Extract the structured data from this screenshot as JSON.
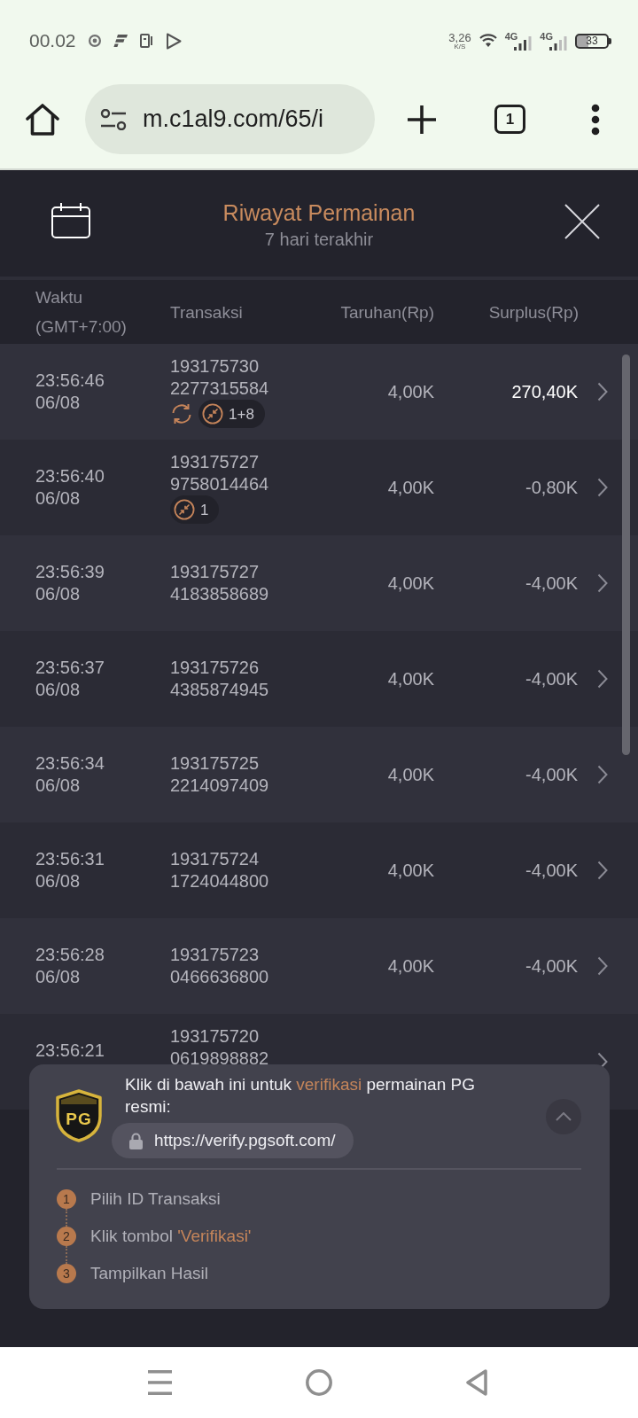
{
  "status_bar": {
    "time": "00.02",
    "net_speed": "3,26",
    "net_speed_unit": "K/S",
    "networks": [
      {
        "label": "4G"
      },
      {
        "label": "4G"
      }
    ],
    "battery": "33"
  },
  "browser_bar": {
    "url": "m.c1al9.com/65/i",
    "tab_count": "1"
  },
  "header": {
    "title": "Riwayat Permainan",
    "subtitle": "7 hari terakhir"
  },
  "table": {
    "columns": [
      "Waktu (GMT+7:00)",
      "Transaksi",
      "Taruhan(Rp)",
      "Surplus(Rp)"
    ],
    "rows": [
      {
        "time": "23:56:46",
        "date": "06/08",
        "transaction_id": [
          "193175730",
          "2277315584"
        ],
        "bet": "4,00K",
        "surplus": "270,40K",
        "positive": true,
        "tags": [
          {
            "kind": "refresh"
          },
          {
            "kind": "count",
            "text": "1+8"
          }
        ]
      },
      {
        "time": "23:56:40",
        "date": "06/08",
        "transaction_id": [
          "193175727",
          "9758014464"
        ],
        "bet": "4,00K",
        "surplus": "-0,80K",
        "positive": false,
        "tags": [
          {
            "kind": "count",
            "text": "1"
          }
        ]
      },
      {
        "time": "23:56:39",
        "date": "06/08",
        "transaction_id": [
          "193175727",
          "4183858689"
        ],
        "bet": "4,00K",
        "surplus": "-4,00K",
        "positive": false
      },
      {
        "time": "23:56:37",
        "date": "06/08",
        "transaction_id": [
          "193175726",
          "4385874945"
        ],
        "bet": "4,00K",
        "surplus": "-4,00K",
        "positive": false
      },
      {
        "time": "23:56:34",
        "date": "06/08",
        "transaction_id": [
          "193175725",
          "2214097409"
        ],
        "bet": "4,00K",
        "surplus": "-4,00K",
        "positive": false
      },
      {
        "time": "23:56:31",
        "date": "06/08",
        "transaction_id": [
          "193175724",
          "1724044800"
        ],
        "bet": "4,00K",
        "surplus": "-4,00K",
        "positive": false
      },
      {
        "time": "23:56:28",
        "date": "06/08",
        "transaction_id": [
          "193175723",
          "0466636800"
        ],
        "bet": "4,00K",
        "surplus": "-4,00K",
        "positive": false
      },
      {
        "time": "23:56:21",
        "transaction_id": [
          "193175720",
          "0619898882"
        ]
      }
    ]
  },
  "verify_panel": {
    "logo_text": "PG",
    "message": [
      {
        "text": "Klik di bawah ini untuk ",
        "accent": false
      },
      {
        "text": "verifikasi",
        "accent": true
      },
      {
        "text": " permainan PG resmi:",
        "accent": false
      }
    ],
    "link": "https://verify.pgsoft.com/",
    "expanded": true,
    "steps": [
      {
        "number": "1",
        "text": [
          {
            "text": "Pilih ID Transaksi",
            "accent": false
          }
        ]
      },
      {
        "number": "2",
        "text": [
          {
            "text": "Klik tombol ",
            "accent": false
          },
          {
            "text": "'Verifikasi'",
            "accent": true
          }
        ]
      },
      {
        "number": "3",
        "text": [
          {
            "text": "Tampilkan Hasil",
            "accent": false
          }
        ]
      }
    ]
  }
}
